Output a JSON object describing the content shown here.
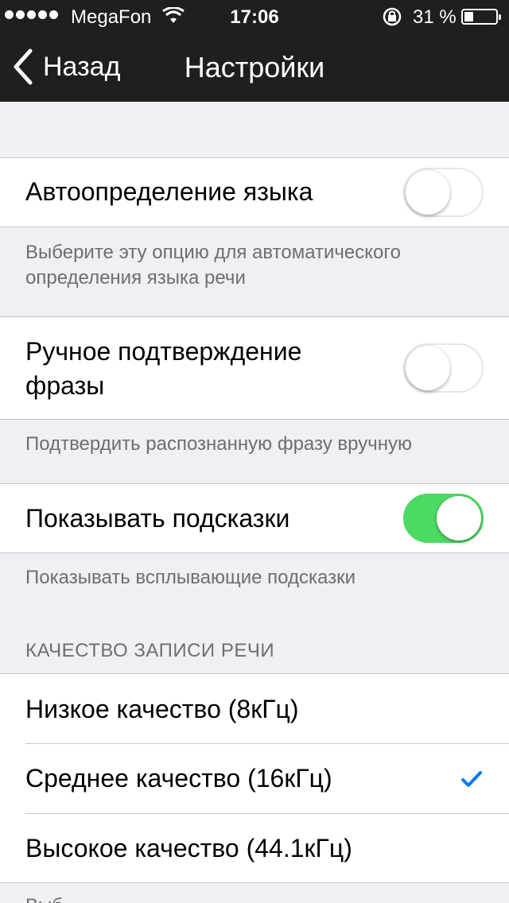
{
  "status_bar": {
    "carrier": "MegaFon",
    "time": "17:06",
    "battery_percent": "31 %",
    "signal_icon": "signal-dots-icon",
    "wifi_icon": "wifi-icon",
    "rotation_lock_icon": "rotation-lock-icon",
    "battery_level": 0.31
  },
  "nav": {
    "back_label": "Назад",
    "title": "Настройки"
  },
  "settings": {
    "auto_language": {
      "label": "Автоопределение языка",
      "on": false,
      "footer": "Выберите эту опцию для автоматического определения языка речи"
    },
    "manual_confirm": {
      "label_line1": "Ручное подтверждение",
      "label_line2": "фразы",
      "on": false,
      "footer": "Подтвердить распознанную фразу вручную"
    },
    "show_hints": {
      "label": "Показывать подсказки",
      "on": true,
      "footer": "Показывать всплывающие подсказки"
    }
  },
  "quality": {
    "header": "КАЧЕСТВО ЗАПИСИ РЕЧИ",
    "options": [
      {
        "label": "Низкое качество (8кГц)",
        "selected": false
      },
      {
        "label": "Среднее качество (16кГц)",
        "selected": true
      },
      {
        "label": "Высокое качество (44.1кГц)",
        "selected": false
      }
    ],
    "footer_partial": "Выб..."
  },
  "colors": {
    "nav_bg": "#1f1f1f",
    "switch_on": "#4cd964",
    "checkmark": "#007aff",
    "group_bg": "#efeff4"
  }
}
